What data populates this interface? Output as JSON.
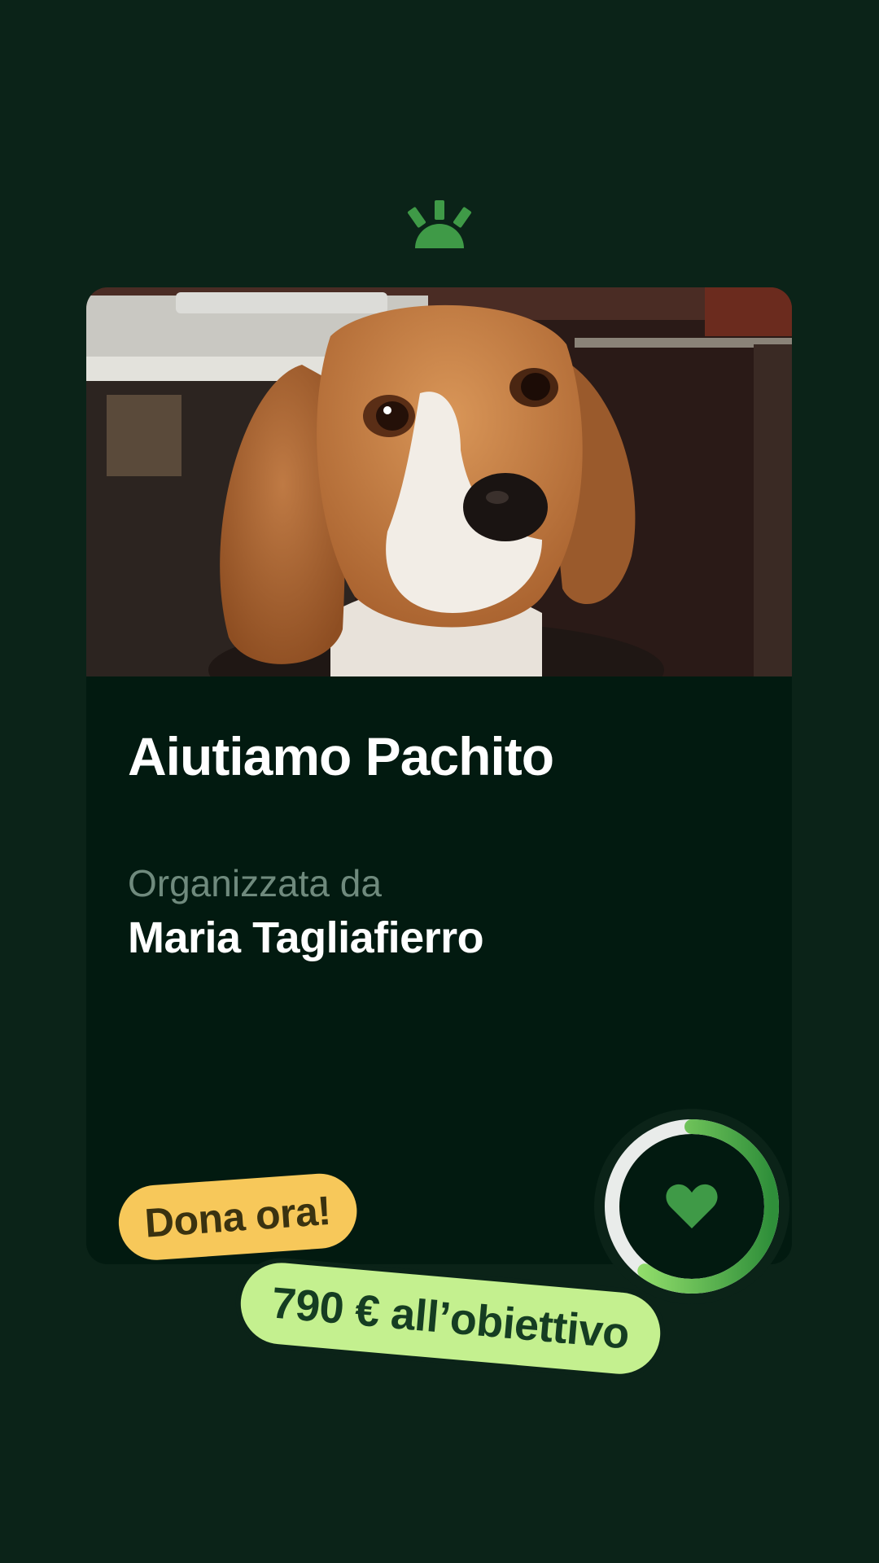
{
  "brand": {
    "logo_icon": "sunrise-logo-icon",
    "accent_color": "#3f9a47"
  },
  "campaign": {
    "title": "Aiutiamo Pachito",
    "organizer_label": "Organizzata da",
    "organizer_name": "Maria Tagliafierro",
    "photo_alt": "Beagle"
  },
  "progress": {
    "fraction": 0.6,
    "icon": "heart-icon"
  },
  "cta": {
    "donate_label": "Dona ora!",
    "goal_label": "790 € all’obiettivo"
  },
  "colors": {
    "background": "#0b2318",
    "card": "#021a10",
    "donate_tag": "#f7c85a",
    "goal_tag": "#c4f08f",
    "progress": "#4fb84c"
  }
}
